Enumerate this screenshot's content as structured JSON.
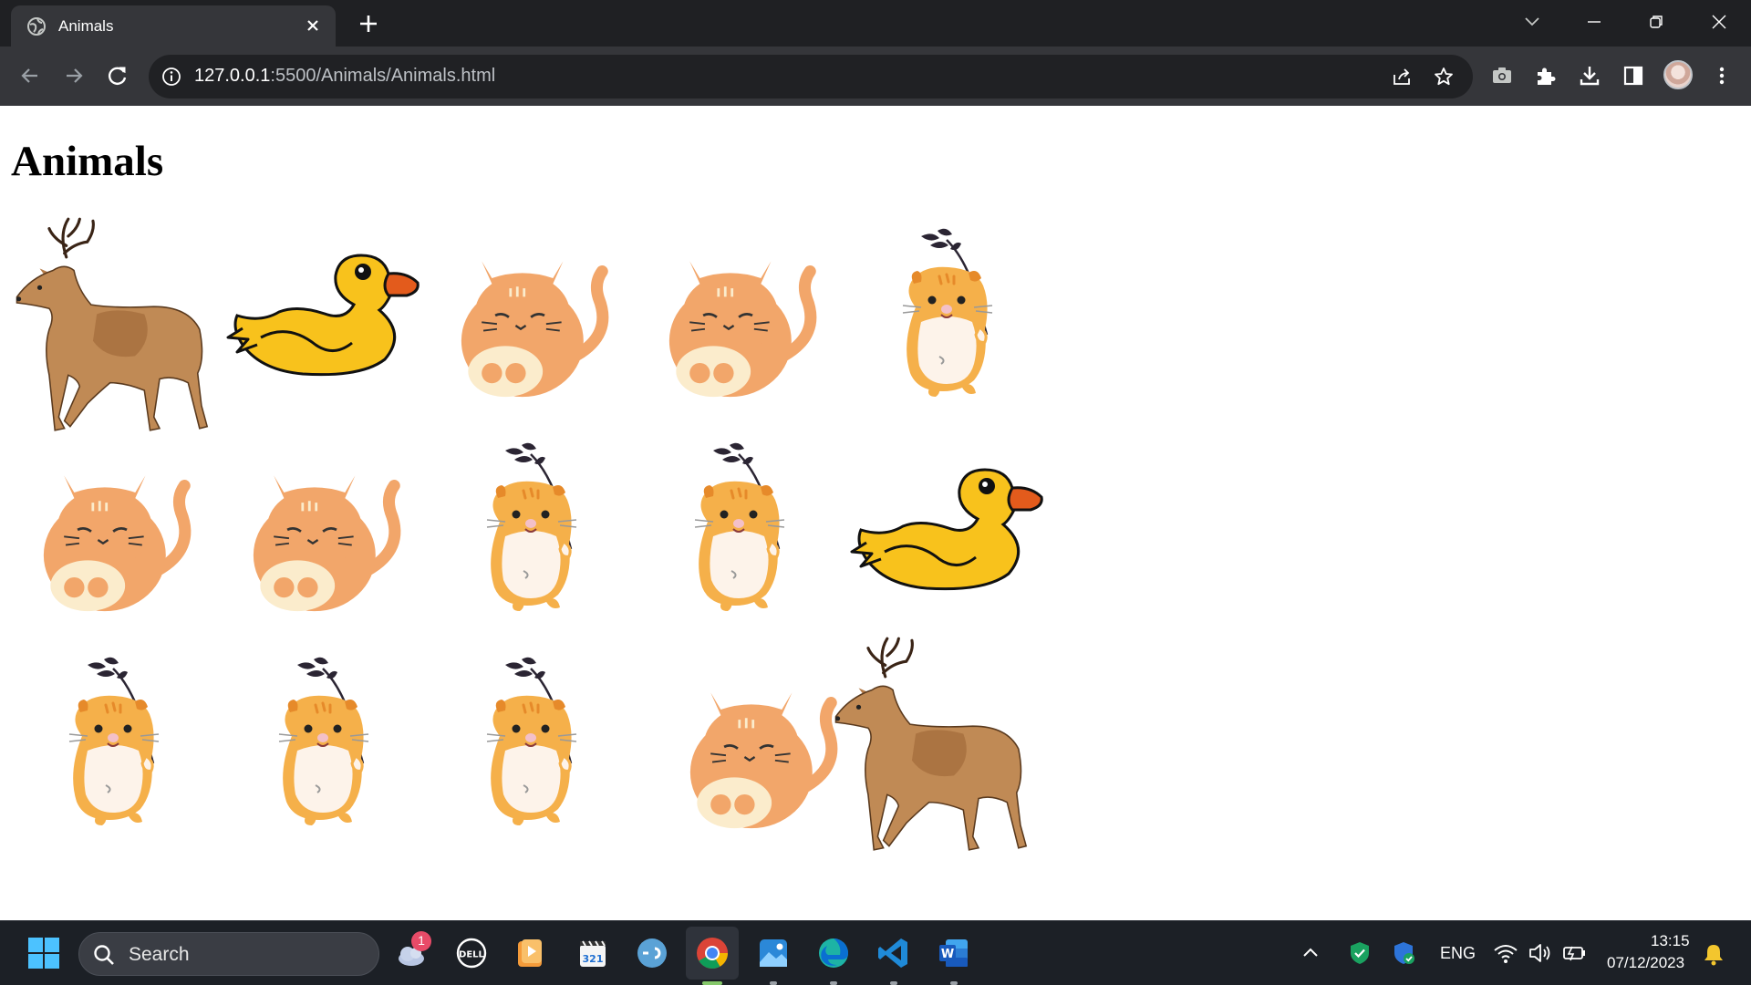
{
  "browser": {
    "tab_title": "Animals",
    "url_host": "127.0.0.1",
    "url_rest": ":5500/Animals/Animals.html"
  },
  "page": {
    "heading": "Animals",
    "grid": [
      [
        "deer",
        "duck",
        "cat",
        "cat",
        "hamster"
      ],
      [
        "cat",
        "cat",
        "hamster",
        "hamster",
        "duck"
      ],
      [
        "hamster",
        "hamster",
        "hamster",
        "cat",
        "deer"
      ]
    ]
  },
  "taskbar": {
    "search_placeholder": "Search",
    "weather_badge": "1",
    "language": "ENG",
    "time": "13:15",
    "date": "07/12/2023"
  },
  "colors": {
    "chrome_dark": "#1f2023",
    "chrome_toolbar": "#35363a",
    "cat_body": "#f2a66a",
    "duck_body": "#f8c21c",
    "duck_beak": "#e35b1c",
    "deer_body": "#c08a55",
    "hamster_body": "#f5b04a"
  }
}
